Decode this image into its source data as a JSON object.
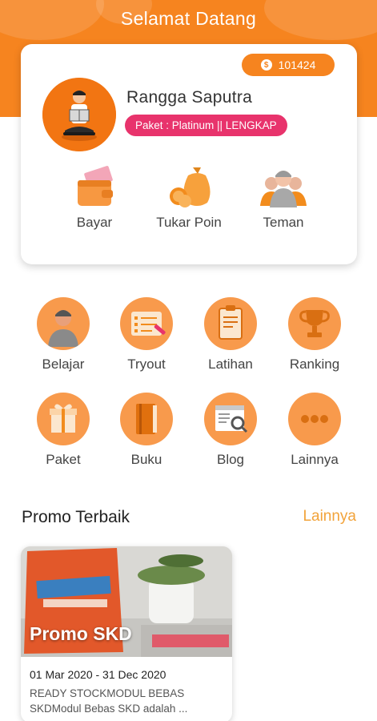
{
  "header": {
    "title": "Selamat Datang"
  },
  "profile": {
    "coins": "101424",
    "coin_symbol": "$",
    "name": "Rangga Saputra",
    "package": "Paket : Platinum || LENGKAP"
  },
  "card_actions": [
    {
      "label": "Bayar",
      "icon": "wallet-icon"
    },
    {
      "label": "Tukar Poin",
      "icon": "money-bag-icon"
    },
    {
      "label": "Teman",
      "icon": "friends-icon"
    }
  ],
  "menu": [
    {
      "label": "Belajar",
      "icon": "student-icon"
    },
    {
      "label": "Tryout",
      "icon": "checklist-icon"
    },
    {
      "label": "Latihan",
      "icon": "clipboard-icon"
    },
    {
      "label": "Ranking",
      "icon": "trophy-icon"
    },
    {
      "label": "Paket",
      "icon": "gift-icon"
    },
    {
      "label": "Buku",
      "icon": "book-icon"
    },
    {
      "label": "Blog",
      "icon": "blog-search-icon"
    },
    {
      "label": "Lainnya",
      "icon": "more-dots-icon"
    }
  ],
  "promo_section": {
    "title": "Promo Terbaik",
    "more_link": "Lainnya"
  },
  "promos": [
    {
      "overlay_title": "Promo SKD",
      "date": "01 Mar 2020 - 31 Dec 2020",
      "description": "READY STOCKMODUL BEBAS SKDModul Bebas SKD adalah ..."
    }
  ],
  "colors": {
    "primary": "#f6841f",
    "menu_circle": "#f89a4c",
    "badge_pink": "#e8336c",
    "link": "#f2a33a"
  }
}
